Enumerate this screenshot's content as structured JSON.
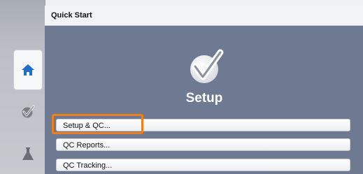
{
  "panel": {
    "title": "Quick Start"
  },
  "hero": {
    "title": "Setup",
    "icon": "setup-check-icon"
  },
  "menu": {
    "items": [
      {
        "label": "Setup & QC..."
      },
      {
        "label": "QC Reports..."
      },
      {
        "label": "QC Tracking..."
      }
    ]
  },
  "sidebar": {
    "items": [
      {
        "icon": "home-icon",
        "active": true
      },
      {
        "icon": "check-shield-icon"
      },
      {
        "icon": "flask-icon"
      }
    ]
  },
  "colors": {
    "panel_bg": "#6d7a91",
    "accent": "#1f6fc8",
    "highlight": "#f07e1c"
  }
}
